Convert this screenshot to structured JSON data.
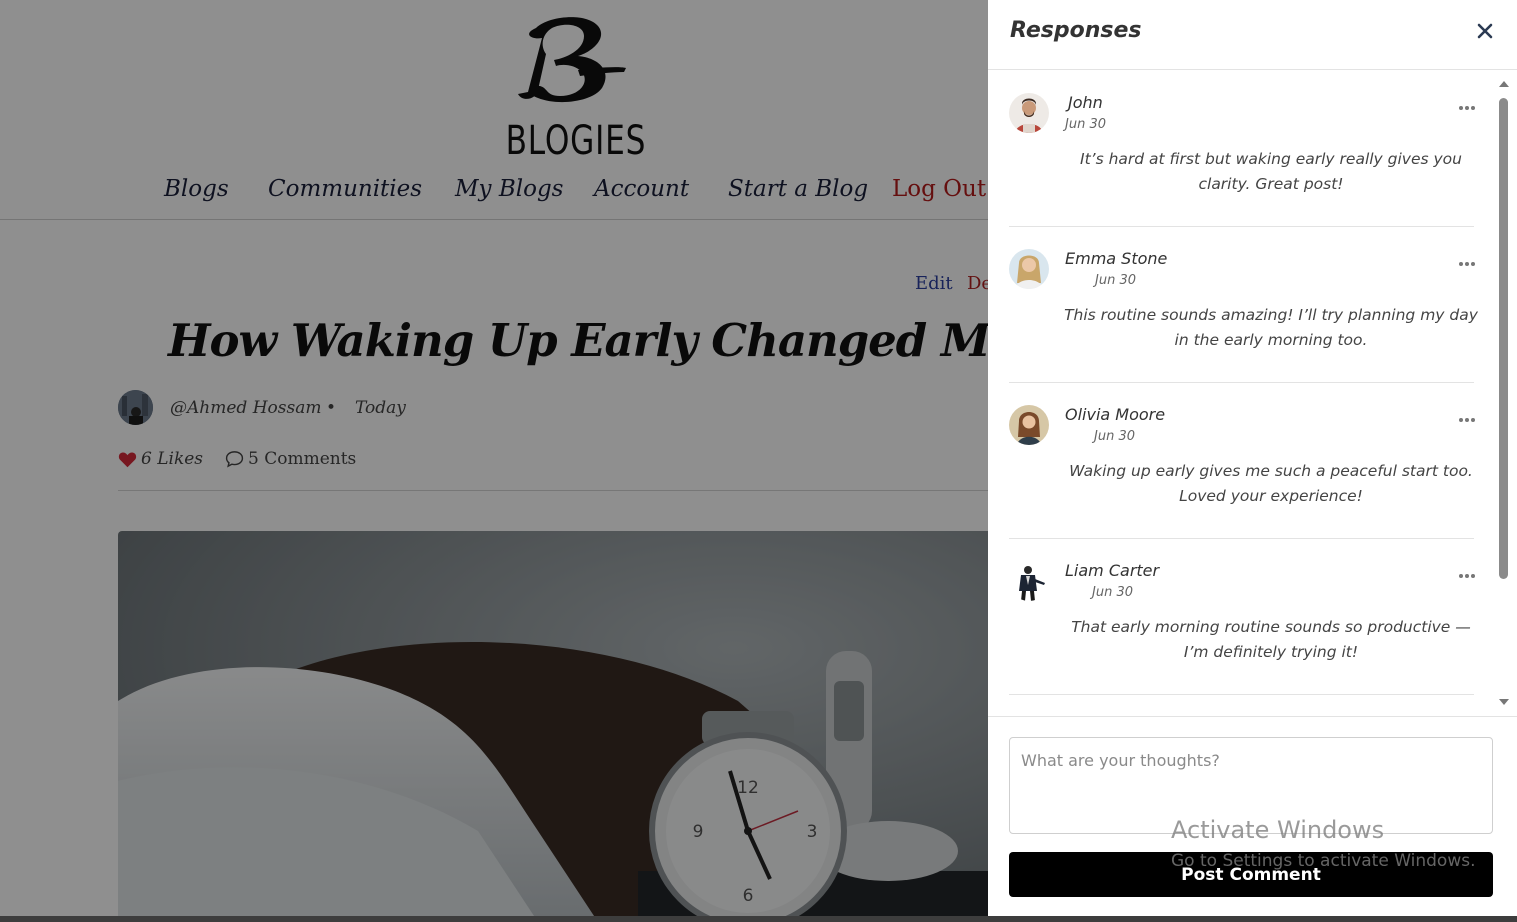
{
  "site": {
    "logo_text": "BLOGIES"
  },
  "nav": {
    "blogs": "Blogs",
    "communities": "Communities",
    "my_blogs": "My Blogs",
    "account": "Account",
    "start_blog": "Start a Blog",
    "logout": "Log Out"
  },
  "post": {
    "edit_label": "Edit",
    "delete_label": "De",
    "title": "How Waking Up Early Changed My Life",
    "author": "@Ahmed Hossam",
    "separator": "•",
    "date": "Today",
    "likes": "6 Likes",
    "comments": "5 Comments"
  },
  "responses": {
    "title": "Responses",
    "comments": [
      {
        "name": "John",
        "date": "Jun 30",
        "text": "It’s hard at first but waking early really gives you clarity. Great post!"
      },
      {
        "name": "Emma Stone",
        "date": "Jun 30",
        "text": "This routine sounds amazing! I’ll try planning my day in the early morning too."
      },
      {
        "name": "Olivia Moore",
        "date": "Jun 30",
        "text": "Waking up early gives me such a peaceful start too. Loved your experience!"
      },
      {
        "name": "Liam Carter",
        "date": "Jun 30",
        "text": "That early morning routine sounds so productive — I’m definitely trying it!"
      }
    ],
    "input_placeholder": "What are your thoughts?",
    "post_button": "Post Comment"
  },
  "watermark": {
    "title": "Activate Windows",
    "subtitle": "Go to Settings to activate Windows."
  },
  "colors": {
    "logout": "#b51b1b",
    "edit": "#2b3fa0",
    "heart": "#d42a3a",
    "button": "#000000"
  },
  "icons": [
    "heart-icon",
    "comment-bubble-icon",
    "close-icon",
    "more-dots-icon",
    "scroll-up-icon",
    "scroll-down-icon"
  ]
}
